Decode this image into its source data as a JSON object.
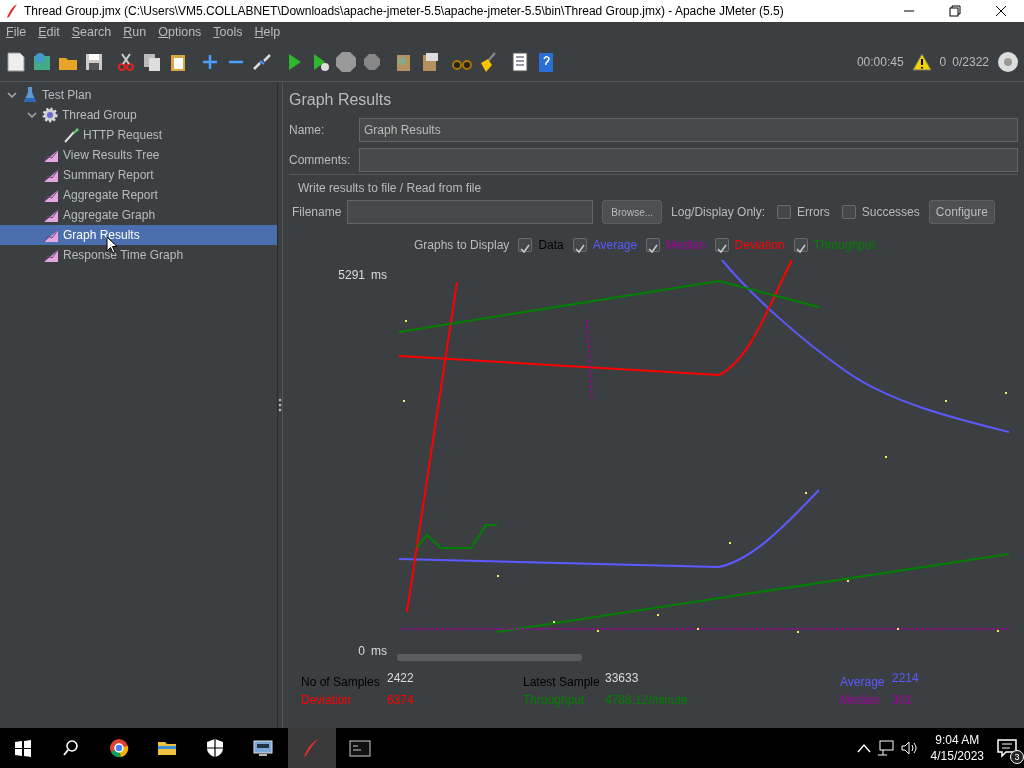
{
  "window": {
    "title": "Thread Group.jmx (C:\\Users\\VM5.COLLABNET\\Downloads\\apache-jmeter-5.5\\apache-jmeter-5.5\\bin\\Thread Group.jmx) - Apache JMeter (5.5)"
  },
  "menu": [
    {
      "label": "File"
    },
    {
      "label": "Edit"
    },
    {
      "label": "Search"
    },
    {
      "label": "Run"
    },
    {
      "label": "Options"
    },
    {
      "label": "Tools"
    },
    {
      "label": "Help"
    }
  ],
  "status": {
    "elapsed": "00:00:45",
    "errors": "0",
    "threads": "0/2322"
  },
  "tree": [
    {
      "label": "Test Plan",
      "kind": "plan",
      "expanded": true,
      "selected": false,
      "children": [
        {
          "label": "Thread Group",
          "kind": "threads",
          "expanded": true,
          "selected": false,
          "children": [
            {
              "label": "HTTP Request",
              "kind": "sampler",
              "selected": false
            }
          ]
        },
        {
          "label": "View Results Tree",
          "kind": "listener",
          "selected": false
        },
        {
          "label": "Summary Report",
          "kind": "listener",
          "selected": false
        },
        {
          "label": "Aggregate Report",
          "kind": "listener",
          "selected": false
        },
        {
          "label": "Aggregate Graph",
          "kind": "listener",
          "selected": false
        },
        {
          "label": "Graph Results",
          "kind": "listener",
          "selected": true
        },
        {
          "label": "Response Time Graph",
          "kind": "listener",
          "selected": false
        }
      ]
    }
  ],
  "panel": {
    "title": "Graph Results",
    "name_label": "Name:",
    "name_value": "Graph Results",
    "comments_label": "Comments:",
    "file_section": "Write results to file / Read from file",
    "filename_label": "Filename",
    "browse": "Browse...",
    "log_label": "Log/Display Only:",
    "log_options": [
      {
        "label": "Errors",
        "checked": false
      },
      {
        "label": "Successes",
        "checked": false
      }
    ],
    "configure": "Configure",
    "graphs_label": "Graphs to Display",
    "graph_options": [
      {
        "label": "Data",
        "checked": true,
        "color": "#000000"
      },
      {
        "label": "Average",
        "checked": true,
        "color": "#5a5aff"
      },
      {
        "label": "Median",
        "checked": true,
        "color": "#a000a0"
      },
      {
        "label": "Deviation",
        "checked": true,
        "color": "#ff0000"
      },
      {
        "label": "Throughput",
        "checked": true,
        "color": "#008000"
      }
    ],
    "y_axis": {
      "max": "5291",
      "max_unit": "ms",
      "min": "0",
      "min_unit": "ms"
    },
    "stats": [
      [
        {
          "label": "No of Samples",
          "value": "2422",
          "color": "#000000"
        },
        {
          "label": "Latest Sample",
          "value": "33633",
          "color": "#000000"
        },
        {
          "label": "Average",
          "value": "2214",
          "color": "#5a5aff"
        }
      ],
      [
        {
          "label": "Deviation",
          "value": "6374",
          "color": "#ff0000"
        },
        {
          "label": "Throughput",
          "value": "4788.12/minute",
          "color": "#008000"
        },
        {
          "label": "Median",
          "value": "301",
          "color": "#a000a0"
        }
      ]
    ]
  },
  "taskbar": {
    "time": "9:04 AM",
    "date": "4/15/2023",
    "notifications": "3"
  }
}
